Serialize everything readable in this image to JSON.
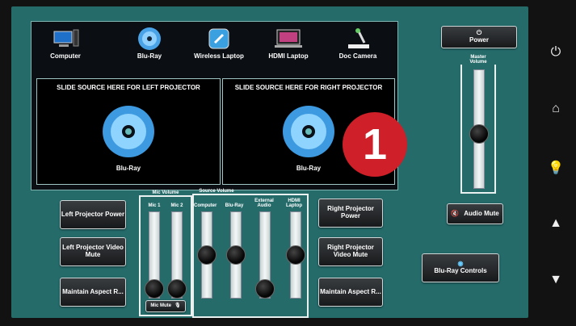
{
  "sources": [
    {
      "label": "Computer",
      "icon": "computer-icon"
    },
    {
      "label": "Blu-Ray",
      "icon": "bluray-disc-icon"
    },
    {
      "label": "Wireless Laptop",
      "icon": "wireless-laptop-icon"
    },
    {
      "label": "HDMI Laptop",
      "icon": "hdmi-laptop-icon"
    },
    {
      "label": "Doc Camera",
      "icon": "doc-camera-icon"
    }
  ],
  "left_drop": {
    "title": "SLIDE SOURCE HERE FOR LEFT PROJECTOR",
    "source": "Blu-Ray"
  },
  "right_drop": {
    "title": "SLIDE SOURCE HERE FOR RIGHT PROJECTOR",
    "source": "Blu-Ray"
  },
  "power": {
    "label": "Power",
    "icon": "power-icon"
  },
  "master_volume": {
    "label": "Master Volume",
    "level": 0.45
  },
  "audio_mute": {
    "label": "Audio Mute",
    "icon": "speaker-mute-icon"
  },
  "bluray_controls": {
    "label": "Blu-Ray Controls",
    "icon": "bluray-logo-icon"
  },
  "left_buttons": [
    "Left Projector Power",
    "Left Projector Video Mute",
    "Maintain Aspect R..."
  ],
  "right_buttons": [
    "Right Projector Power",
    "Right Projector Video Mute",
    "Maintain Aspect R..."
  ],
  "mic_volume": {
    "title": "Mic Volume",
    "channels": [
      {
        "label": "Mic 1",
        "level": 0.0
      },
      {
        "label": "Mic 2",
        "level": 0.0
      }
    ],
    "mute_label": "Mic Mute"
  },
  "source_volume": {
    "title": "Source Volume",
    "channels": [
      {
        "label": "Computer",
        "level": 0.55
      },
      {
        "label": "Blu-Ray",
        "level": 0.55
      },
      {
        "label": "External Audio",
        "level": 0.0
      },
      {
        "label": "HDMI Laptop",
        "level": 0.55
      }
    ]
  },
  "badge": {
    "text": "1"
  },
  "side_icons": [
    "power-icon",
    "home-icon",
    "lightbulb-icon",
    "up-arrow-icon",
    "down-arrow-icon"
  ],
  "colors": {
    "panel": "#256b6a",
    "badge": "#cf1f28"
  }
}
